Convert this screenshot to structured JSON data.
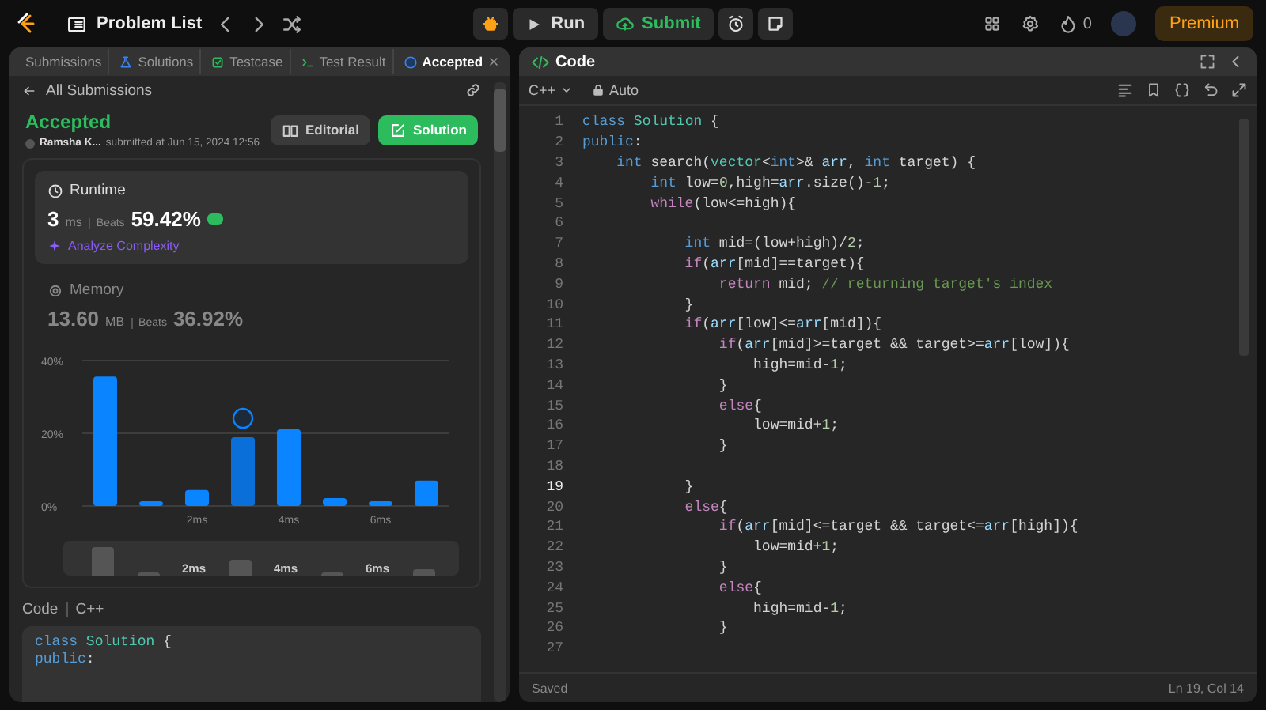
{
  "top_bar": {
    "title": "Problem List",
    "run": "Run",
    "submit": "Submit",
    "streak": "0",
    "premium": "Premium"
  },
  "left_panel": {
    "tabs": [
      {
        "label": "Submissions",
        "selected": false
      },
      {
        "label": "Solutions",
        "selected": false
      },
      {
        "label": "Testcase",
        "selected": false
      },
      {
        "label": "Test Result",
        "selected": false
      },
      {
        "label": "Accepted",
        "selected": true
      }
    ],
    "back_link": "All Submissions",
    "submission": {
      "status": "Accepted",
      "user": "Ramsha K...",
      "submitted": "submitted at Jun 15, 2024 12:56",
      "buttons": [
        "Editorial",
        "Solution"
      ]
    },
    "metrics": [
      {
        "label": "Runtime",
        "value": "3",
        "unit": "ms",
        "beats_label": "Beats",
        "beats": "59.42%",
        "selected": true,
        "link": "Analyze Complexity"
      },
      {
        "label": "Memory",
        "value": "13.60",
        "unit": "MB",
        "beats_label": "Beats",
        "beats": "36.92%",
        "selected": false
      }
    ],
    "distribution": {
      "chart_data": {
        "type": "bar",
        "x": [
          0,
          1,
          2,
          3,
          4,
          5,
          6,
          7
        ],
        "values": [
          35.6,
          1.3,
          4.4,
          18.9,
          21.1,
          2.2,
          1.3,
          7.0
        ],
        "xlim": [
          -0.5,
          7.5
        ],
        "ylim": [
          0,
          40
        ],
        "yticks": [
          {
            "value": 0,
            "label": "0%"
          },
          {
            "value": 20,
            "label": "20%"
          },
          {
            "value": 40,
            "label": "40%"
          }
        ],
        "xticks": [
          {
            "value": 2,
            "label": "2ms"
          },
          {
            "value": 4,
            "label": "4ms"
          },
          {
            "value": 6,
            "label": "6ms"
          }
        ]
      },
      "bars": [
        {
          "selected": false
        },
        {
          "selected": false
        },
        {
          "selected": false
        },
        {
          "selected": true
        },
        {
          "selected": false
        },
        {
          "selected": false
        },
        {
          "selected": false
        },
        {
          "selected": false
        }
      ]
    },
    "navigator": {
      "labels": [
        "2ms",
        "4ms",
        "6ms"
      ]
    },
    "code_label": "Code",
    "code_language": "C++",
    "code_preview": [
      [
        {
          "kind": "kw",
          "text": "class"
        },
        {
          "kind": "ty",
          "text": " Solution"
        },
        {
          "kind": "pl",
          "text": " {"
        }
      ],
      [
        {
          "kind": "kw",
          "text": "public"
        },
        {
          "kind": "pl",
          "text": ":"
        }
      ]
    ]
  },
  "editor": {
    "title": "Code",
    "language": "C++",
    "mode": "Auto",
    "status": "Saved",
    "cursor": "Ln 19, Col 14",
    "lines": [
      {
        "n": "1",
        "current": false,
        "segs": [
          {
            "kind": "kw",
            "text": "class"
          },
          {
            "kind": "ty",
            "text": " Solution"
          },
          {
            "kind": "pl",
            "text": " {"
          }
        ]
      },
      {
        "n": "2",
        "current": false,
        "segs": [
          {
            "kind": "kw",
            "text": "public"
          },
          {
            "kind": "pl",
            "text": ":"
          }
        ]
      },
      {
        "n": "3",
        "current": false,
        "segs": [
          {
            "kind": "kw",
            "text": "    int"
          },
          {
            "kind": "pl",
            "text": " search("
          },
          {
            "kind": "ty",
            "text": "vector"
          },
          {
            "kind": "pl",
            "text": "<"
          },
          {
            "kind": "kw",
            "text": "int"
          },
          {
            "kind": "pl",
            "text": ">& "
          },
          {
            "kind": "vr",
            "text": "arr"
          },
          {
            "kind": "pl",
            "text": ", "
          },
          {
            "kind": "kw",
            "text": "int"
          },
          {
            "kind": "pl",
            "text": " target) {"
          }
        ]
      },
      {
        "n": "4",
        "current": false,
        "segs": [
          {
            "kind": "kw",
            "text": "        int"
          },
          {
            "kind": "pl",
            "text": " low="
          },
          {
            "kind": "nu",
            "text": "0"
          },
          {
            "kind": "pl",
            "text": ",high="
          },
          {
            "kind": "vr",
            "text": "arr"
          },
          {
            "kind": "pl",
            "text": ".size()-"
          },
          {
            "kind": "nu",
            "text": "1"
          },
          {
            "kind": "pl",
            "text": ";"
          }
        ]
      },
      {
        "n": "5",
        "current": false,
        "segs": [
          {
            "kind": "ct",
            "text": "        while"
          },
          {
            "kind": "pl",
            "text": "(low<=high){"
          }
        ]
      },
      {
        "n": "6",
        "current": false
      },
      {
        "n": "7",
        "current": false,
        "segs": [
          {
            "kind": "kw",
            "text": "            int"
          },
          {
            "kind": "pl",
            "text": " mid=(low+high)/"
          },
          {
            "kind": "nu",
            "text": "2"
          },
          {
            "kind": "pl",
            "text": ";"
          }
        ]
      },
      {
        "n": "8",
        "current": false,
        "segs": [
          {
            "kind": "ct",
            "text": "            if"
          },
          {
            "kind": "pl",
            "text": "("
          },
          {
            "kind": "vr",
            "text": "arr"
          },
          {
            "kind": "pl",
            "text": "[mid]==target){"
          }
        ]
      },
      {
        "n": "9",
        "current": false,
        "segs": [
          {
            "kind": "ct",
            "text": "                return"
          },
          {
            "kind": "pl",
            "text": " mid; "
          },
          {
            "kind": "cm",
            "text": "// returning target's index"
          }
        ]
      },
      {
        "n": "10",
        "current": false,
        "segs": [
          {
            "kind": "pl",
            "text": "            }"
          }
        ]
      },
      {
        "n": "11",
        "current": false,
        "segs": [
          {
            "kind": "ct",
            "text": "            if"
          },
          {
            "kind": "pl",
            "text": "("
          },
          {
            "kind": "vr",
            "text": "arr"
          },
          {
            "kind": "pl",
            "text": "[low]<="
          },
          {
            "kind": "vr",
            "text": "arr"
          },
          {
            "kind": "pl",
            "text": "[mid]){"
          }
        ]
      },
      {
        "n": "12",
        "current": false,
        "segs": [
          {
            "kind": "ct",
            "text": "                if"
          },
          {
            "kind": "pl",
            "text": "("
          },
          {
            "kind": "vr",
            "text": "arr"
          },
          {
            "kind": "pl",
            "text": "[mid]>=target && target>="
          },
          {
            "kind": "vr",
            "text": "arr"
          },
          {
            "kind": "pl",
            "text": "[low]){"
          }
        ]
      },
      {
        "n": "13",
        "current": false,
        "segs": [
          {
            "kind": "pl",
            "text": "                    high=mid-"
          },
          {
            "kind": "nu",
            "text": "1"
          },
          {
            "kind": "pl",
            "text": ";"
          }
        ]
      },
      {
        "n": "14",
        "current": false,
        "segs": [
          {
            "kind": "pl",
            "text": "                }"
          }
        ]
      },
      {
        "n": "15",
        "current": false,
        "segs": [
          {
            "kind": "ct",
            "text": "                else"
          },
          {
            "kind": "pl",
            "text": "{"
          }
        ]
      },
      {
        "n": "16",
        "current": false,
        "segs": [
          {
            "kind": "pl",
            "text": "                    low=mid+"
          },
          {
            "kind": "nu",
            "text": "1"
          },
          {
            "kind": "pl",
            "text": ";"
          }
        ]
      },
      {
        "n": "17",
        "current": false,
        "segs": [
          {
            "kind": "pl",
            "text": "                }"
          }
        ]
      },
      {
        "n": "18",
        "current": false
      },
      {
        "n": "19",
        "current": true,
        "segs": [
          {
            "kind": "pl",
            "text": "            }"
          }
        ]
      },
      {
        "n": "20",
        "current": false,
        "segs": [
          {
            "kind": "ct",
            "text": "            else"
          },
          {
            "kind": "pl",
            "text": "{"
          }
        ]
      },
      {
        "n": "21",
        "current": false,
        "segs": [
          {
            "kind": "ct",
            "text": "                if"
          },
          {
            "kind": "pl",
            "text": "("
          },
          {
            "kind": "vr",
            "text": "arr"
          },
          {
            "kind": "pl",
            "text": "[mid]<=target && target<="
          },
          {
            "kind": "vr",
            "text": "arr"
          },
          {
            "kind": "pl",
            "text": "[high]){"
          }
        ]
      },
      {
        "n": "22",
        "current": false,
        "segs": [
          {
            "kind": "pl",
            "text": "                    low=mid+"
          },
          {
            "kind": "nu",
            "text": "1"
          },
          {
            "kind": "pl",
            "text": ";"
          }
        ]
      },
      {
        "n": "23",
        "current": false,
        "segs": [
          {
            "kind": "pl",
            "text": "                }"
          }
        ]
      },
      {
        "n": "24",
        "current": false,
        "segs": [
          {
            "kind": "ct",
            "text": "                else"
          },
          {
            "kind": "pl",
            "text": "{"
          }
        ]
      },
      {
        "n": "25",
        "current": false,
        "segs": [
          {
            "kind": "pl",
            "text": "                    high=mid-"
          },
          {
            "kind": "nu",
            "text": "1"
          },
          {
            "kind": "pl",
            "text": ";"
          }
        ]
      },
      {
        "n": "26",
        "current": false,
        "segs": [
          {
            "kind": "pl",
            "text": "                }"
          }
        ]
      },
      {
        "n": "27",
        "current": false
      }
    ]
  }
}
